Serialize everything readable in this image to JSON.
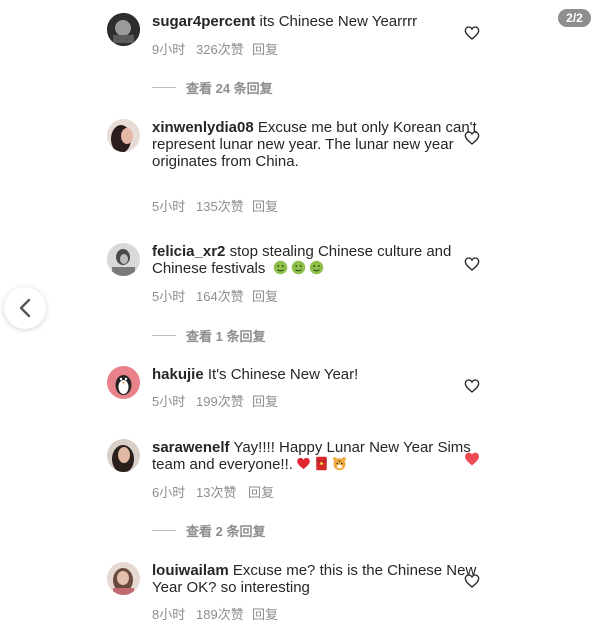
{
  "pager": {
    "label": "2/2"
  },
  "comments": [
    {
      "username": "sugar4percent",
      "text": "its Chinese New Yearrrr",
      "time": "9小时",
      "likes": "326次赞",
      "reply": "回复",
      "liked": false,
      "view_replies": "查看 24 条回复",
      "avatar_color": "#3c3c3c"
    },
    {
      "username": "xinwenlydia08",
      "text": "Excuse me but only Korean can't represent lunar new year. The lunar new year originates from China.",
      "time": "5小时",
      "likes": "135次赞",
      "reply": "回复",
      "liked": false,
      "avatar_color": "#c98a7a"
    },
    {
      "username": "felicia_xr2",
      "text": "stop stealing Chinese culture and Chinese festivals",
      "emojis": [
        "nauseated-face-icon",
        "nauseated-face-icon",
        "nauseated-face-icon"
      ],
      "time": "5小时",
      "likes": "164次赞",
      "reply": "回复",
      "liked": false,
      "view_replies": "查看 1 条回复",
      "avatar_color": "#6a6a6a"
    },
    {
      "username": "hakujie",
      "text": "It's Chinese New Year!",
      "time": "5小时",
      "likes": "199次赞",
      "reply": "回复",
      "liked": false,
      "avatar_color": "#e8828a"
    },
    {
      "username": "sarawenelf",
      "text": "Yay!!!! Happy Lunar New Year Sims team and everyone!!.",
      "emojis": [
        "red-heart-icon",
        "red-envelope-icon",
        "tiger-face-icon"
      ],
      "time": "6小时",
      "likes": "13次赞",
      "reply": "回复",
      "liked": true,
      "view_replies": "查看 2 条回复",
      "avatar_color": "#7a6458"
    },
    {
      "username": "louiwailam",
      "text": "Excuse me? this is the Chinese New Year OK? so interesting",
      "time": "8小时",
      "likes": "189次赞",
      "reply": "回复",
      "liked": false,
      "avatar_color": "#b59a8e"
    }
  ],
  "colors": {
    "like_red": "#ed4956",
    "meta_gray": "#8e8e8e",
    "text": "#262626"
  }
}
